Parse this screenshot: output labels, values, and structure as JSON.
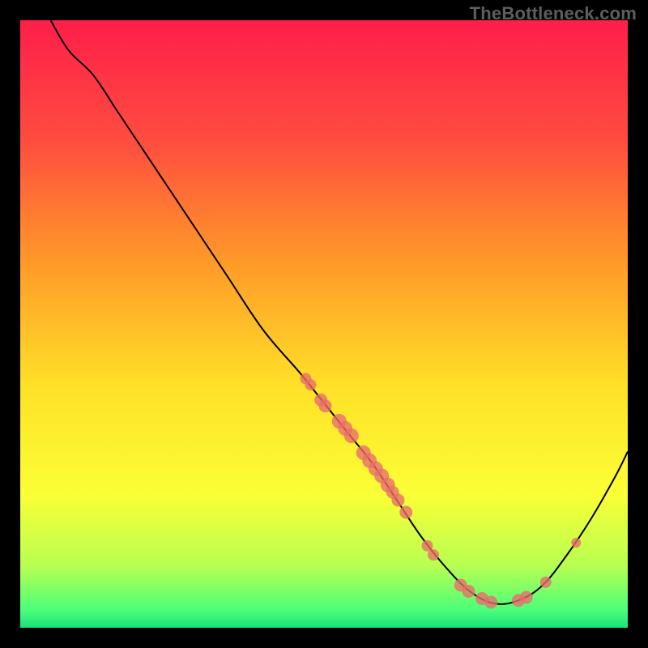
{
  "watermark": "TheBottleneck.com",
  "chart_data": {
    "type": "line",
    "title": "",
    "xlabel": "",
    "ylabel": "",
    "xlim": [
      0,
      100
    ],
    "ylim": [
      0,
      100
    ],
    "grid": false,
    "legend": false,
    "background": "rainbow-gradient",
    "gradient_stops": [
      {
        "offset": 0.0,
        "color": "#ff1e4a"
      },
      {
        "offset": 0.2,
        "color": "#ff4d3f"
      },
      {
        "offset": 0.4,
        "color": "#ff9a28"
      },
      {
        "offset": 0.6,
        "color": "#ffe028"
      },
      {
        "offset": 0.78,
        "color": "#fbff35"
      },
      {
        "offset": 0.9,
        "color": "#b6ff52"
      },
      {
        "offset": 0.97,
        "color": "#4dff7a"
      },
      {
        "offset": 1.0,
        "color": "#18e27a"
      }
    ],
    "series": [
      {
        "name": "curve",
        "color": "#000000",
        "width": 2,
        "points": [
          {
            "x": 5,
            "y": 100
          },
          {
            "x": 8,
            "y": 95
          },
          {
            "x": 12,
            "y": 91
          },
          {
            "x": 16,
            "y": 85
          },
          {
            "x": 22,
            "y": 76
          },
          {
            "x": 28,
            "y": 67
          },
          {
            "x": 34,
            "y": 58
          },
          {
            "x": 40,
            "y": 49
          },
          {
            "x": 46,
            "y": 42
          },
          {
            "x": 50,
            "y": 37
          },
          {
            "x": 54,
            "y": 32
          },
          {
            "x": 58,
            "y": 27
          },
          {
            "x": 62,
            "y": 21
          },
          {
            "x": 66,
            "y": 15
          },
          {
            "x": 70,
            "y": 10
          },
          {
            "x": 74,
            "y": 6
          },
          {
            "x": 78,
            "y": 4
          },
          {
            "x": 82,
            "y": 4.5
          },
          {
            "x": 86,
            "y": 7
          },
          {
            "x": 90,
            "y": 12
          },
          {
            "x": 94,
            "y": 18
          },
          {
            "x": 98,
            "y": 25
          },
          {
            "x": 100,
            "y": 29
          }
        ]
      }
    ],
    "markers": {
      "color": "#e96b6b",
      "opacity": 0.78,
      "radius_min": 6,
      "radius_max": 10,
      "points": [
        {
          "x": 47.0,
          "y": 41.0,
          "r": 7
        },
        {
          "x": 47.8,
          "y": 40.0,
          "r": 7
        },
        {
          "x": 49.5,
          "y": 37.5,
          "r": 8
        },
        {
          "x": 50.2,
          "y": 36.5,
          "r": 8
        },
        {
          "x": 52.5,
          "y": 34.0,
          "r": 9
        },
        {
          "x": 53.5,
          "y": 32.8,
          "r": 9
        },
        {
          "x": 54.5,
          "y": 31.6,
          "r": 9
        },
        {
          "x": 56.5,
          "y": 28.8,
          "r": 9
        },
        {
          "x": 57.5,
          "y": 27.5,
          "r": 9
        },
        {
          "x": 58.5,
          "y": 26.2,
          "r": 9
        },
        {
          "x": 59.5,
          "y": 25.0,
          "r": 9
        },
        {
          "x": 60.5,
          "y": 23.5,
          "r": 9
        },
        {
          "x": 61.3,
          "y": 22.3,
          "r": 8
        },
        {
          "x": 62.2,
          "y": 21.0,
          "r": 8
        },
        {
          "x": 63.5,
          "y": 19.0,
          "r": 8
        },
        {
          "x": 67.0,
          "y": 13.5,
          "r": 7
        },
        {
          "x": 68.0,
          "y": 12.0,
          "r": 7
        },
        {
          "x": 72.5,
          "y": 7.0,
          "r": 8
        },
        {
          "x": 73.8,
          "y": 6.0,
          "r": 8
        },
        {
          "x": 76.0,
          "y": 4.8,
          "r": 8
        },
        {
          "x": 77.5,
          "y": 4.2,
          "r": 8
        },
        {
          "x": 82.0,
          "y": 4.5,
          "r": 8
        },
        {
          "x": 83.3,
          "y": 5.0,
          "r": 8
        },
        {
          "x": 86.5,
          "y": 7.5,
          "r": 7
        },
        {
          "x": 91.5,
          "y": 14.0,
          "r": 6
        }
      ]
    }
  }
}
